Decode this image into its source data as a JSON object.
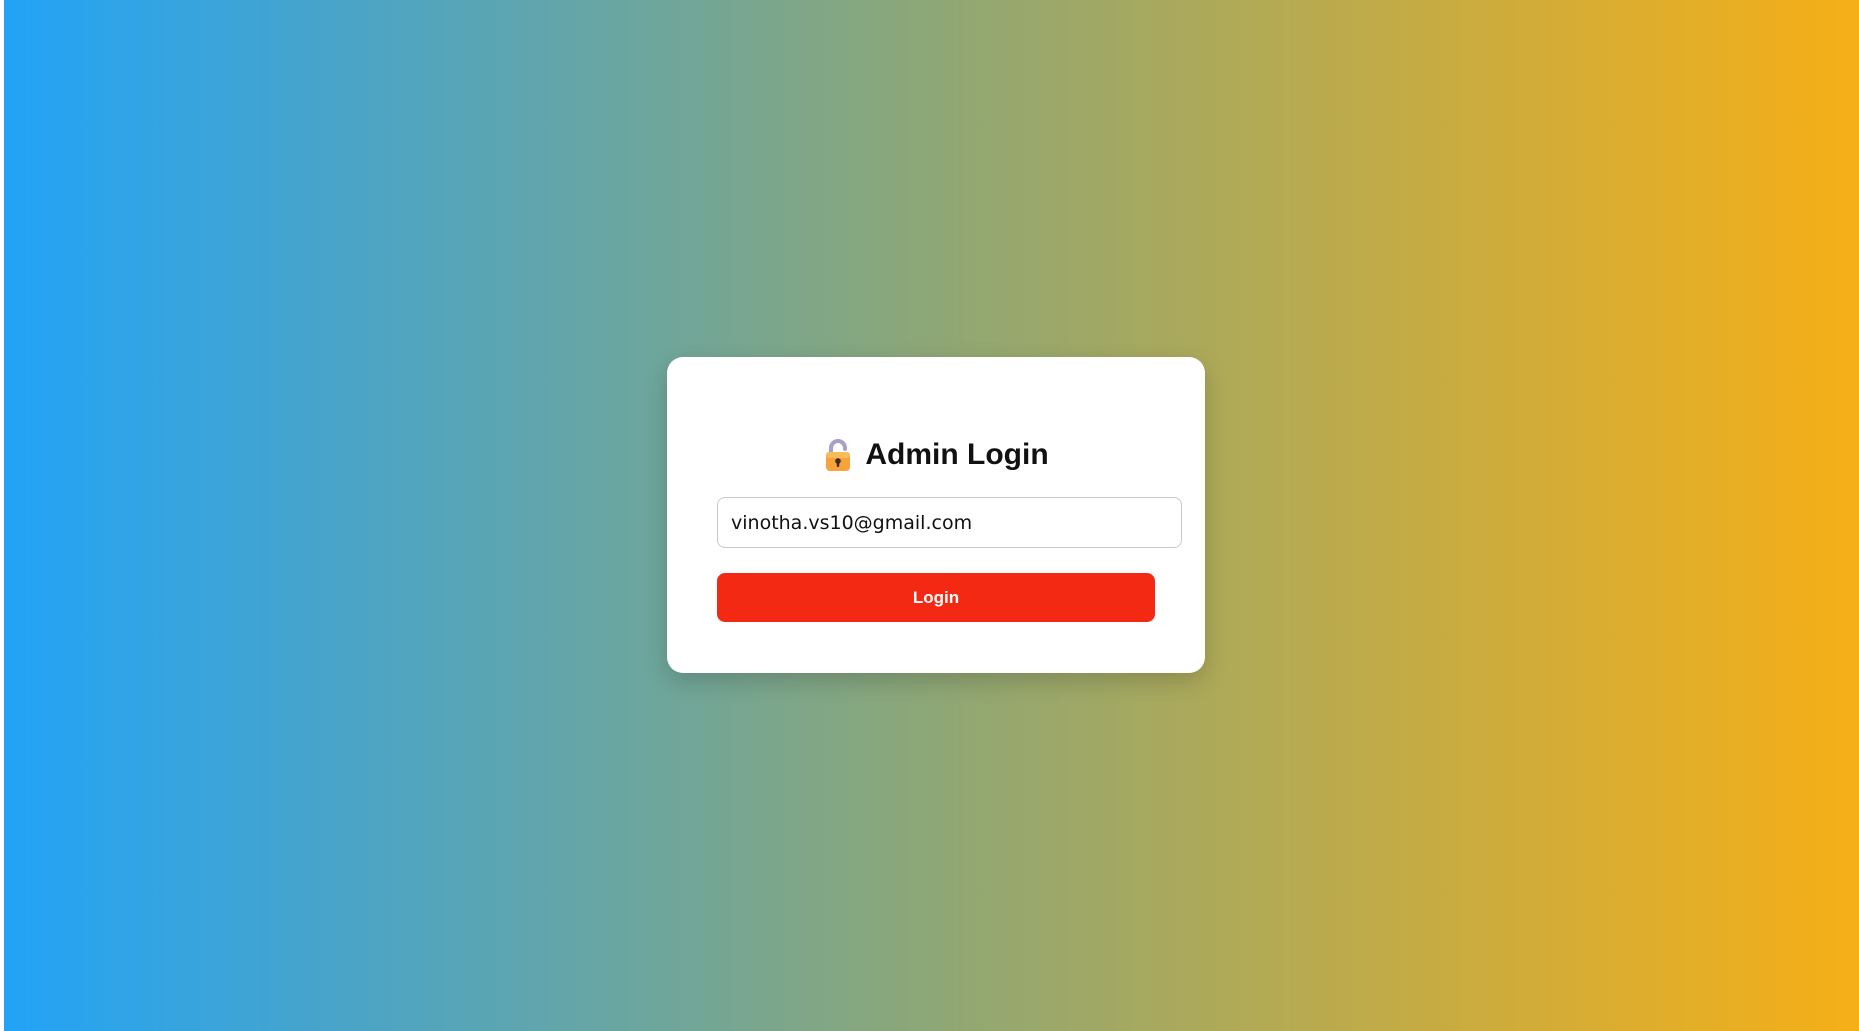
{
  "login": {
    "title": "Admin Login",
    "title_icon": "lock-icon",
    "email_value": "vinotha.vs10@gmail.com",
    "button_label": "Login"
  },
  "colors": {
    "gradient_start": "#22a3f7",
    "gradient_end": "#f6af17",
    "button": "#f42914",
    "card": "#ffffff"
  }
}
